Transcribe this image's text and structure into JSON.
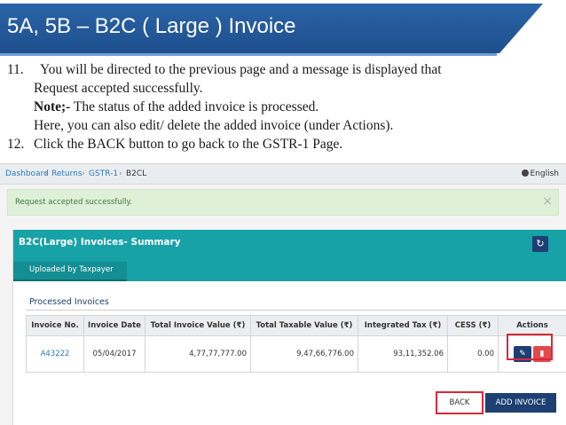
{
  "slide": {
    "title": "5A, 5B – B2C ( Large ) Invoice",
    "step11_num": "11.",
    "step11_line1": "You will be directed to the previous page and a message is displayed that",
    "step11_line2": "Request accepted successfully.",
    "note_label": "Note;-",
    "note_text": " The status of the added invoice is processed.",
    "step11_line4": "Here, you can also edit/ delete the added invoice (under Actions).",
    "step12_num": "12.",
    "step12_text": "Click the BACK button to go back to the GSTR-1 Page."
  },
  "breadcrumb": {
    "items": [
      "Dashboard",
      "Returns",
      "GSTR-1",
      "B2CL"
    ],
    "separator": "›"
  },
  "language": "English",
  "alert": {
    "message": "Request accepted successfully.",
    "close": "×"
  },
  "panel": {
    "title": "B2C(Large) Invoices- Summary",
    "tab": "Uploaded by Taxpayer",
    "refresh_icon": "↻"
  },
  "section": {
    "title": "Processed Invoices"
  },
  "table": {
    "headers": [
      "Invoice No.",
      "Invoice Date",
      "Total Invoice Value (₹)",
      "Total Taxable Value (₹)",
      "Integrated Tax (₹)",
      "CESS (₹)",
      "Actions"
    ],
    "rows": [
      {
        "invoice_no": "A43222",
        "invoice_date": "05/04/2017",
        "total_invoice_value": "4,77,77,777.00",
        "total_taxable_value": "9,47,66,776.00",
        "integrated_tax": "93,11,352.06",
        "cess": "0.00"
      }
    ]
  },
  "icons": {
    "edit": "✎",
    "delete": "▮"
  },
  "buttons": {
    "back": "BACK",
    "add_invoice": "ADD INVOICE"
  },
  "colors": {
    "banner": "#1e4f8c",
    "teal": "#17a2a7",
    "navy": "#1d3f72",
    "highlight": "#d9283a",
    "alert_bg": "#dff0d8"
  }
}
